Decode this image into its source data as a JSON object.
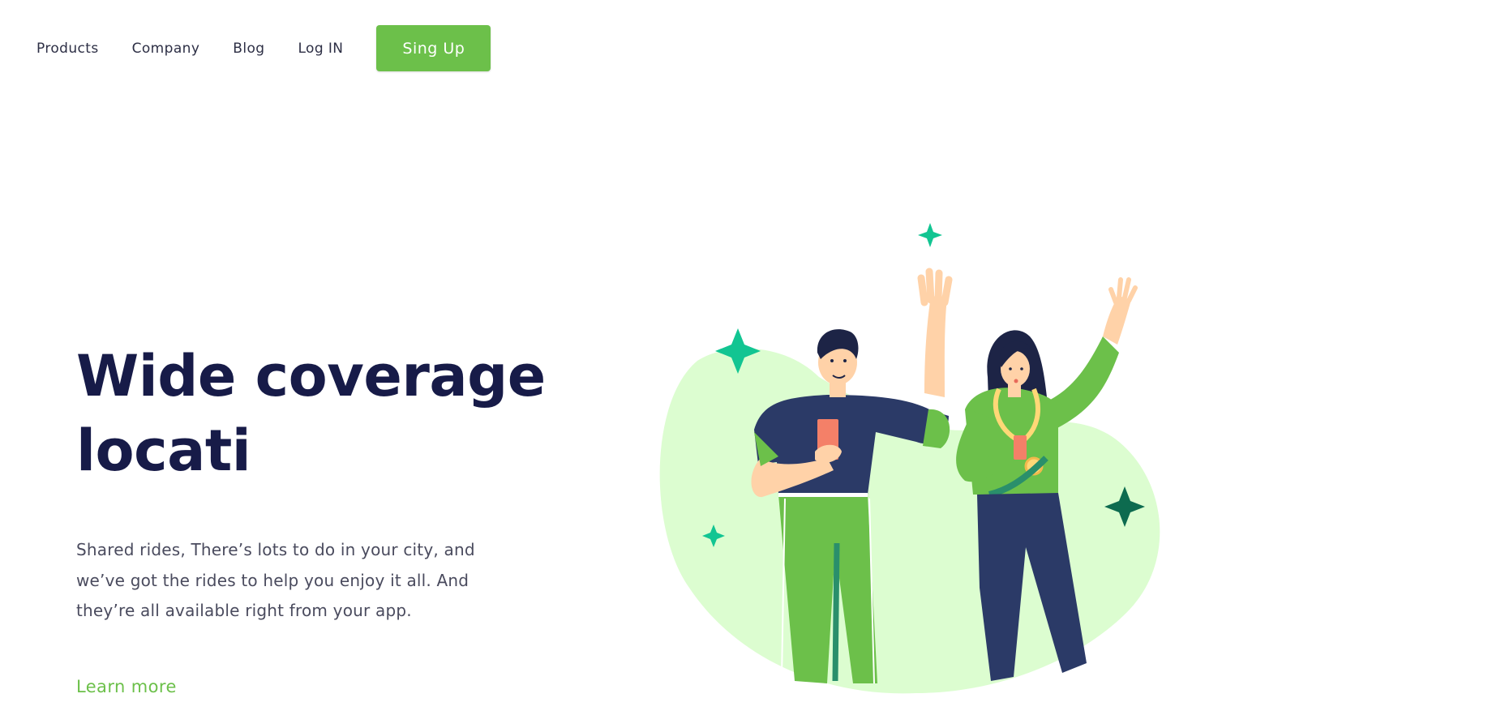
{
  "nav": {
    "items": [
      {
        "label": "Products"
      },
      {
        "label": "Company"
      },
      {
        "label": "Blog"
      },
      {
        "label": "Log IN"
      }
    ],
    "signup_label": "Sing Up"
  },
  "hero": {
    "title_line1": "Wide coverage",
    "title_line2": "locati",
    "description": "Shared rides, There’s lots to do in your city, and we’ve got the rides to help you enjoy it all. And they’re all available right from your app.",
    "learn_more_label": "Learn more"
  },
  "colors": {
    "accent": "#6cc04a",
    "title": "#171b48",
    "blob": "#dcfdd0",
    "navy": "#2d3a63",
    "sparkle": "#12c592",
    "sparkle_dark": "#0d6b4f"
  }
}
